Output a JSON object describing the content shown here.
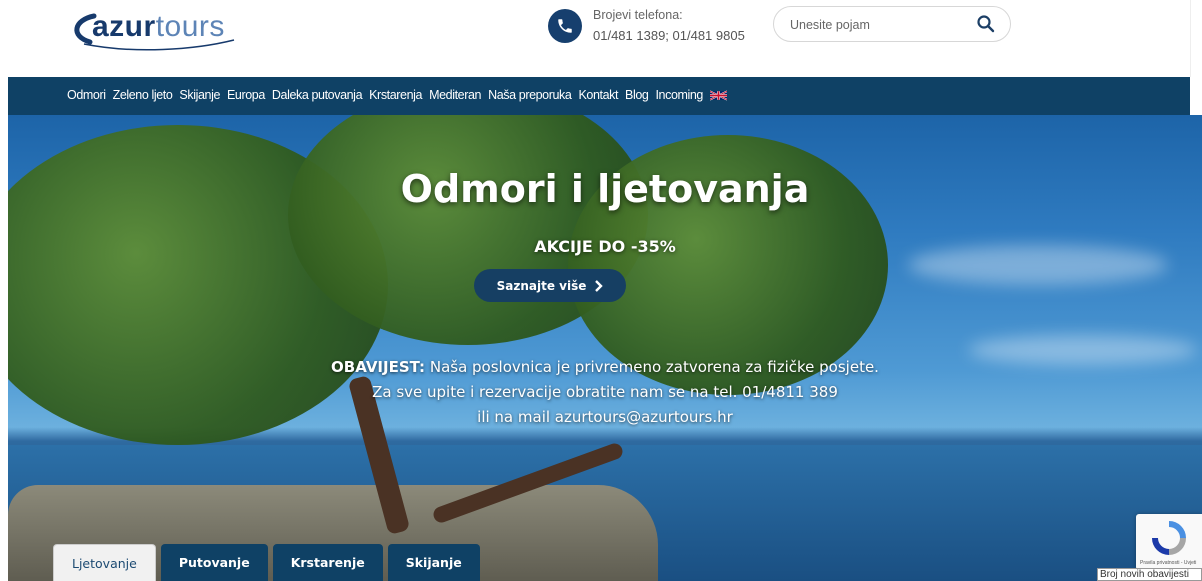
{
  "header": {
    "logo": {
      "part1": "azur",
      "part2": "tours"
    },
    "phone": {
      "label": "Brojevi telefona:",
      "numbers": "01/481 1389; 01/481 9805"
    },
    "search": {
      "placeholder": "Unesite pojam"
    }
  },
  "nav": {
    "items": [
      "Odmori",
      "Zeleno ljeto",
      "Skijanje",
      "Europa",
      "Daleka putovanja",
      "Krstarenja",
      "Mediteran",
      "Naša preporuka",
      "Kontakt",
      "Blog",
      "Incoming"
    ],
    "language_flag_icon": "uk-flag-icon"
  },
  "hero": {
    "title": "Odmori i ljetovanja",
    "subtitle": "AKCIJE DO -35%",
    "cta_label": "Saznajte više",
    "notice": {
      "label": "OBAVIJEST:",
      "line1": "Naša poslovnica je privremeno zatvorena za fizičke posjete.",
      "line2": "Za sve upite i rezervacije obratite nam se na tel. 01/4811 389",
      "line3": "ili na mail azurtours@azurtours.hr"
    }
  },
  "tabs": [
    {
      "label": "Ljetovanje",
      "active": true
    },
    {
      "label": "Putovanje",
      "active": false
    },
    {
      "label": "Krstarenje",
      "active": false
    },
    {
      "label": "Skijanje",
      "active": false
    }
  ],
  "recaptcha": {
    "text": "Pravila privatnosti - Uvjeti"
  },
  "notification": {
    "label": "Broj novih obavijesti"
  },
  "colors": {
    "nav": "#0f4165",
    "brand": "#173a6c",
    "brand_light": "#5d84b6"
  }
}
